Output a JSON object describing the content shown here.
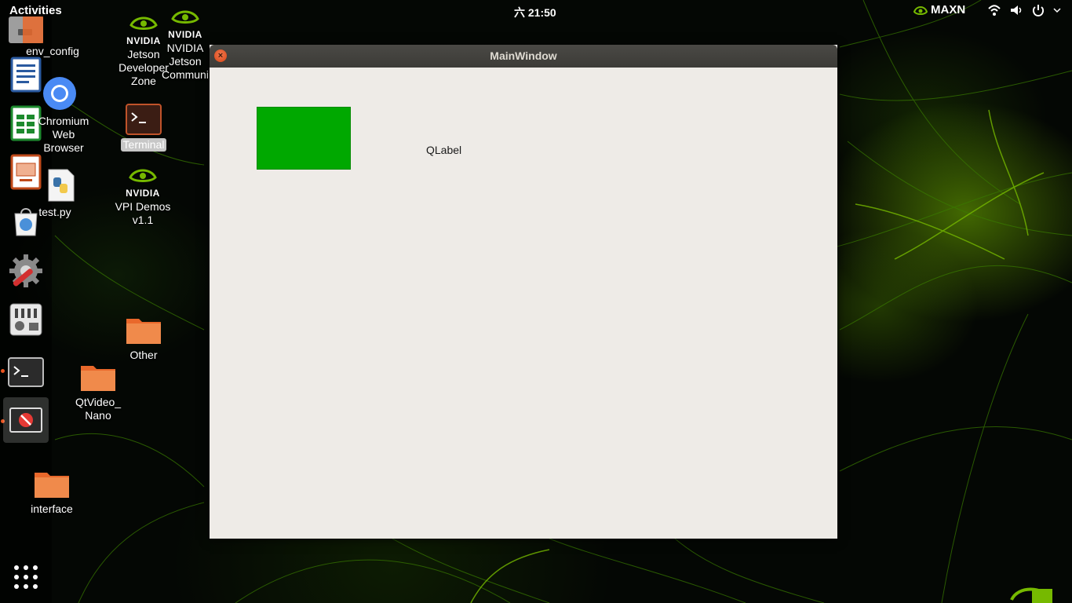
{
  "topbar": {
    "activities": "Activities",
    "clock": "六 21:50",
    "power_mode": "MAXN"
  },
  "desktop": {
    "icons": [
      {
        "label": "env_config"
      },
      {
        "label": "Chromium Web Browser"
      },
      {
        "label": "test.py"
      },
      {
        "label": "Jetson Developer Zone",
        "logo": "NVIDIA"
      },
      {
        "label": "NVIDIA Jetson Communi",
        "logo": "NVIDIA"
      },
      {
        "label": "Terminal"
      },
      {
        "label": "VPI Demos v1.1",
        "logo": "NVIDIA"
      },
      {
        "label": "Other"
      },
      {
        "label": "QtVideo_ Nano"
      },
      {
        "label": "interface"
      }
    ]
  },
  "window": {
    "title": "MainWindow",
    "close_symbol": "×",
    "label_text": "QLabel",
    "box_color": "#00a800"
  },
  "dock": {
    "items": [
      "file-manager-icon",
      "writer-icon",
      "calc-icon",
      "impress-icon",
      "software-icon",
      "settings-icon",
      "tweaks-icon",
      "terminal-icon",
      "app-blocked-icon",
      "app-grid-icon"
    ]
  }
}
